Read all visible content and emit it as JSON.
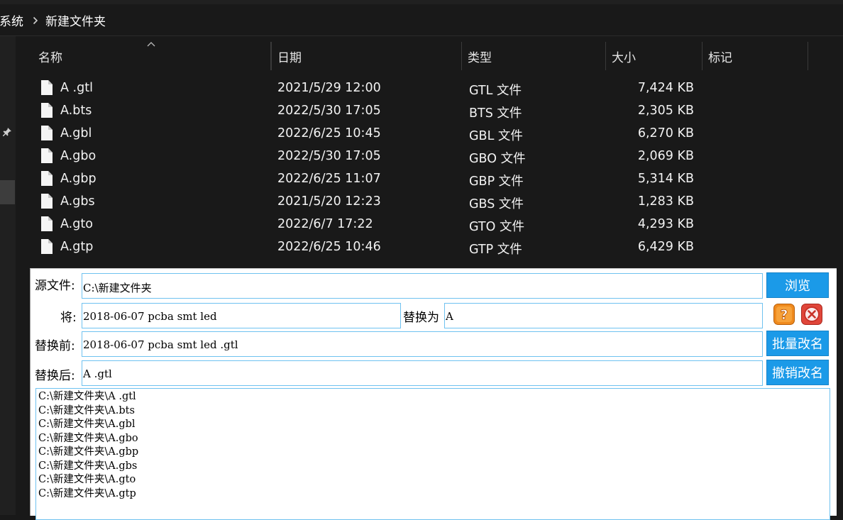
{
  "explorer": {
    "breadcrumb": {
      "parent": "系统",
      "current": "新建文件夹"
    },
    "columns": {
      "name": "名称",
      "date": "日期",
      "type": "类型",
      "size": "大小",
      "tags": "标记"
    },
    "files": [
      {
        "name": "A .gtl",
        "date": "2021/5/29 12:00",
        "type": "GTL 文件",
        "size": "7,424 KB"
      },
      {
        "name": "A.bts",
        "date": "2022/5/30 17:05",
        "type": "BTS 文件",
        "size": "2,305 KB"
      },
      {
        "name": "A.gbl",
        "date": "2022/6/25 10:45",
        "type": "GBL 文件",
        "size": "6,270 KB"
      },
      {
        "name": "A.gbo",
        "date": "2022/5/30 17:05",
        "type": "GBO 文件",
        "size": "2,069 KB"
      },
      {
        "name": "A.gbp",
        "date": "2022/6/25 11:07",
        "type": "GBP 文件",
        "size": "5,314 KB"
      },
      {
        "name": "A.gbs",
        "date": "2021/5/20 12:23",
        "type": "GBS 文件",
        "size": "1,283 KB"
      },
      {
        "name": "A.gto",
        "date": "2022/6/7 17:22",
        "type": "GTO 文件",
        "size": "4,293 KB"
      },
      {
        "name": "A.gtp",
        "date": "2022/6/25 10:46",
        "type": "GTP 文件",
        "size": "6,429 KB"
      }
    ]
  },
  "tool": {
    "source_label": "源文件:",
    "source_value": "C:\\新建文件夹",
    "browse_label": "浏览",
    "find_label": "将:",
    "find_value": "2018-06-07 pcba smt led",
    "replace_label": "替换为",
    "replace_value": "A",
    "before_label": "替换前:",
    "before_value": "2018-06-07 pcba smt led .gtl",
    "batch_rename_label": "批量改名",
    "after_label": "替换后:",
    "after_value": "A .gtl",
    "undo_rename_label": "撤销改名",
    "log_lines": [
      "C:\\新建文件夹\\A .gtl",
      "C:\\新建文件夹\\A.bts",
      "C:\\新建文件夹\\A.gbl",
      "C:\\新建文件夹\\A.gbo",
      "C:\\新建文件夹\\A.gbp",
      "C:\\新建文件夹\\A.gbs",
      "C:\\新建文件夹\\A.gto",
      "C:\\新建文件夹\\A.gtp"
    ]
  },
  "colors": {
    "explorer_bg": "#191919",
    "accent_blue": "#1b9ae8",
    "input_border": "#6fc2f0",
    "help_orange": "#ef8a1e",
    "close_red": "#e0463a"
  },
  "icons": {
    "pin": "pin-icon",
    "file": "file-icon",
    "help": "help-icon",
    "close": "close-icon",
    "sort": "sort-up-icon",
    "separator": "chevron-right-icon"
  }
}
